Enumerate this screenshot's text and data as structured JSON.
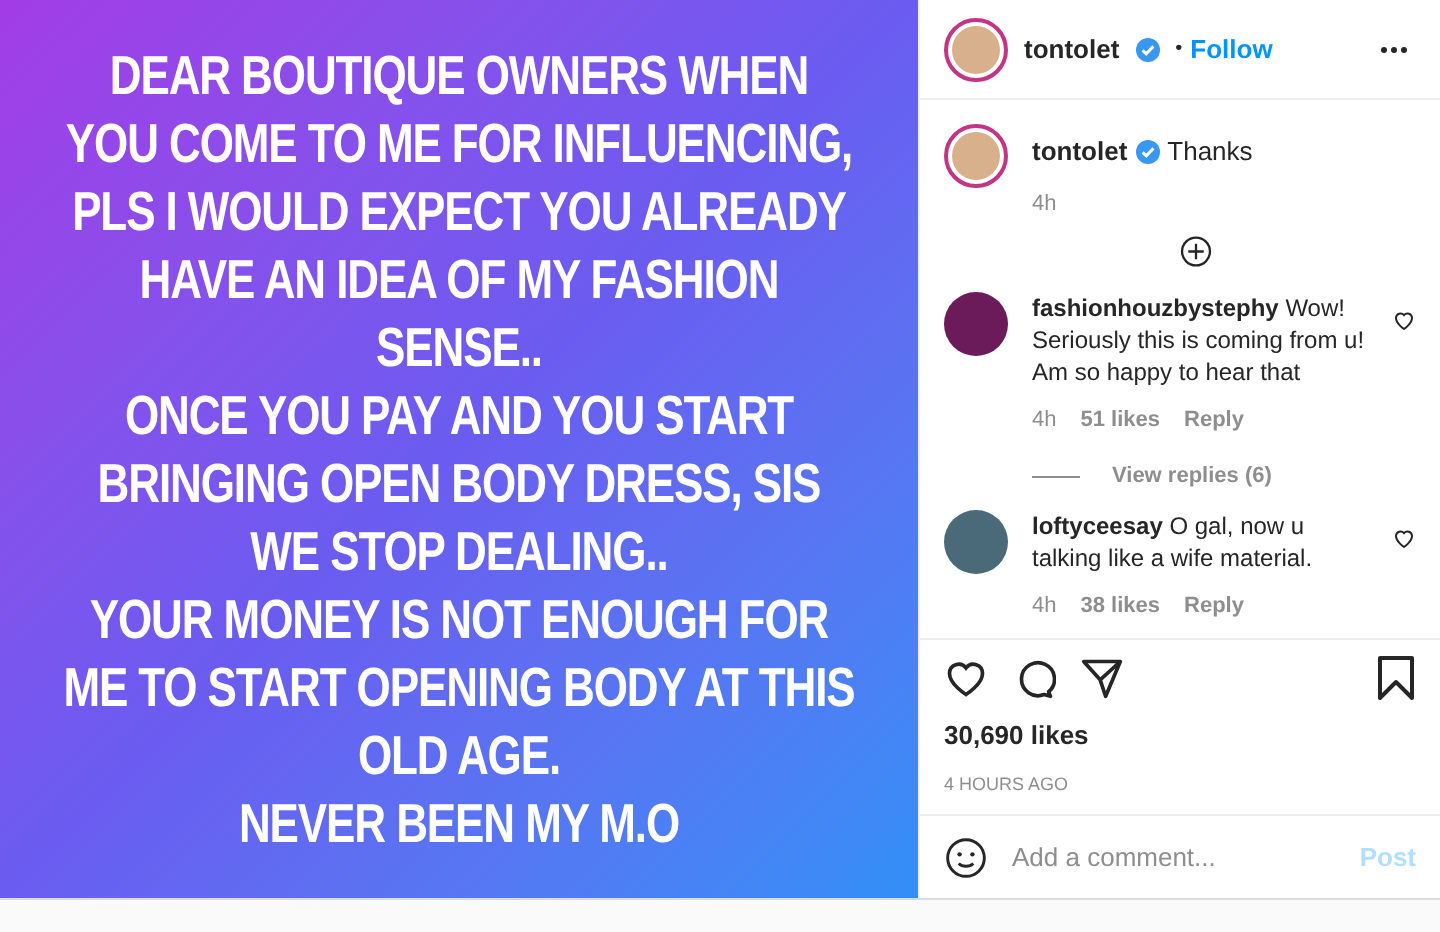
{
  "post_text": [
    "DEAR BOUTIQUE OWNERS WHEN",
    "YOU COME TO ME FOR INFLUENCING,",
    "PLS I WOULD EXPECT YOU ALREADY",
    "HAVE AN IDEA OF MY FASHION",
    "SENSE..",
    "ONCE YOU PAY AND YOU START",
    "BRINGING OPEN BODY DRESS, SIS",
    "WE STOP DEALING..",
    "YOUR MONEY IS NOT ENOUGH FOR",
    "ME TO START OPENING BODY AT THIS",
    "OLD AGE.",
    "NEVER BEEN MY M.O"
  ],
  "header": {
    "username": "tontolet",
    "verified": true,
    "separator": "•",
    "follow": "Follow"
  },
  "caption": {
    "username": "tontolet",
    "verified": true,
    "text": "Thanks",
    "time": "4h"
  },
  "comments": [
    {
      "username": "fashionhouzbystephy",
      "text": "Wow! Seriously this is coming from u! Am so happy to hear that",
      "time": "4h",
      "likes": "51 likes",
      "reply": "Reply",
      "view_replies": "View replies (6)"
    },
    {
      "username": "loftyceesay",
      "text": "O gal, now u talking like a wife material.",
      "time": "4h",
      "likes": "38 likes",
      "reply": "Reply"
    }
  ],
  "likes": "30,690 likes",
  "posted": "4 HOURS AGO",
  "comment_box": {
    "placeholder": "Add a comment...",
    "post": "Post",
    "post_disabled": true
  }
}
